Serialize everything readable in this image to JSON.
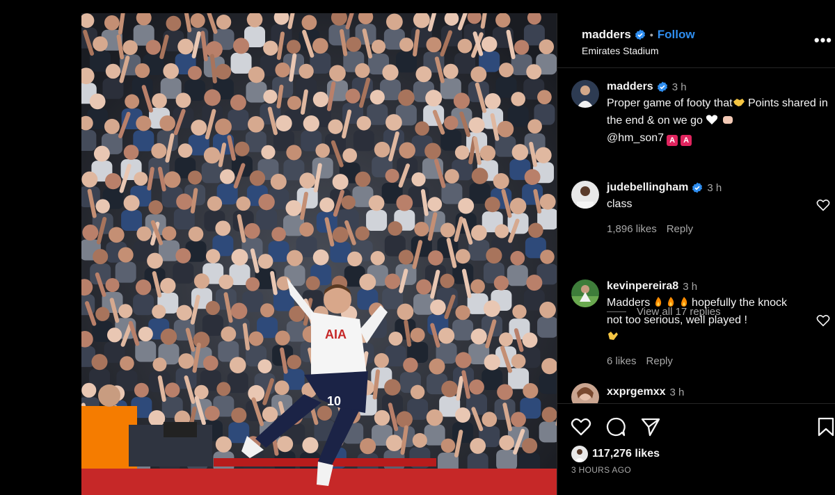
{
  "post": {
    "username": "madders",
    "follow_label": "Follow",
    "location": "Emirates Stadium",
    "more_label": "•••",
    "verified_icon": "verified-badge-icon"
  },
  "caption": {
    "username": "madders",
    "time": "3 h",
    "text_part1": "Proper game of footy that",
    "text_part2": " Points shared in the end & on we go ",
    "mention": "@hm_son7",
    "tag1": "A",
    "tag2": "A"
  },
  "comments": [
    {
      "username": "judebellingham",
      "time": "3 h",
      "text": "class",
      "likes": "1,896 likes",
      "reply_label": "Reply",
      "view_replies": "View all 17 replies"
    },
    {
      "username": "kevinpereira8",
      "time": "3 h",
      "text_part1": "Madders",
      "text_part2": " hopefully the knock not too serious, well played !",
      "likes": "6 likes",
      "reply_label": "Reply"
    },
    {
      "username": "xxprgemxx",
      "time": "3 h"
    }
  ],
  "actions": {
    "likes_count": "117,276 likes",
    "timestamp": "3 HOURS AGO"
  },
  "photo": {
    "jersey_sponsor": "AIA",
    "jersey_number": "10"
  },
  "colors": {
    "accent": "#2f8ef0",
    "background": "#000000",
    "secondary_text": "#a8a8a8",
    "divider": "#262626",
    "ad_board": "#c62828"
  }
}
